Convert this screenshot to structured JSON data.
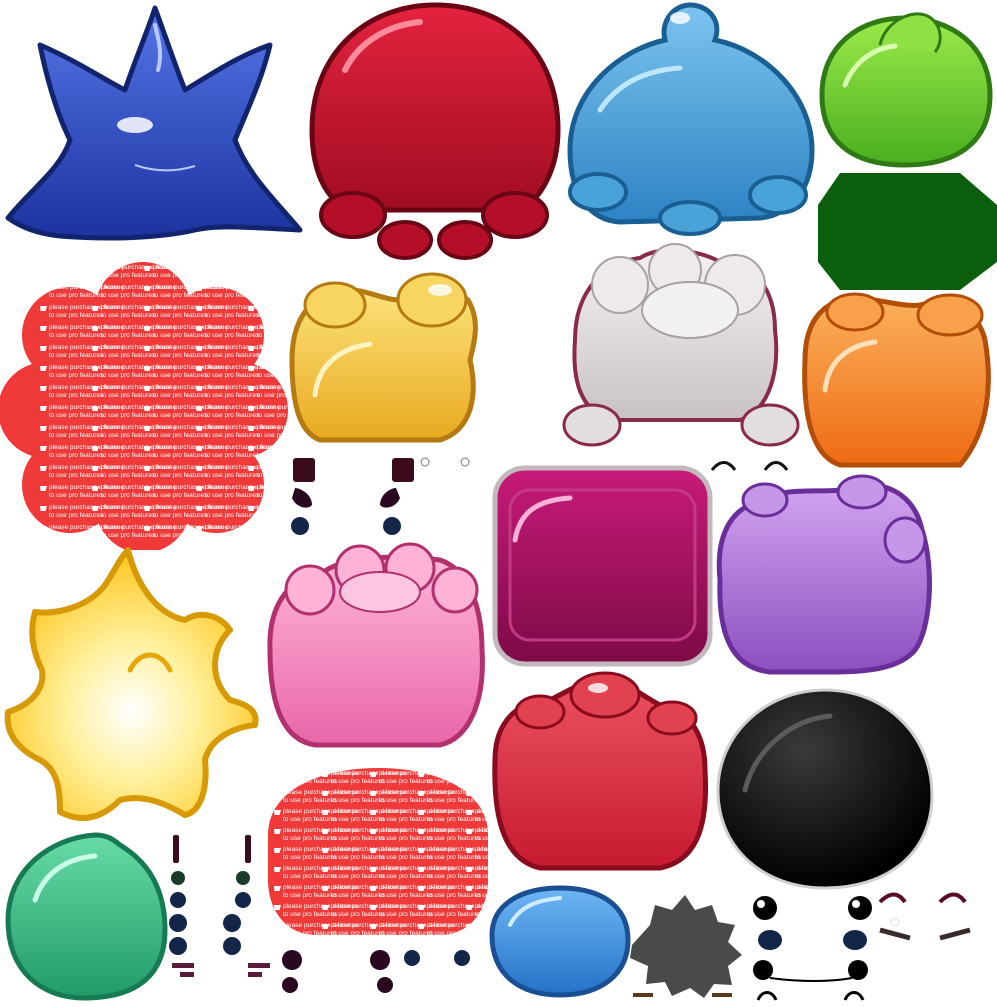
{
  "sheet": {
    "watermark": {
      "line1": "please purchase a license",
      "line2": "to use pro features"
    },
    "sprites": [
      {
        "name": "blue-spiky-slime",
        "color": "#2f4fc4"
      },
      {
        "name": "red-octopus-slime",
        "color": "#c8102e"
      },
      {
        "name": "sky-blue-slime",
        "color": "#4aa3d8"
      },
      {
        "name": "green-drop-slime",
        "color": "#6ccf2e"
      },
      {
        "name": "dark-green-octagon",
        "color": "#0b5e0b"
      },
      {
        "name": "red-flower-slime",
        "color": "#f03a3a"
      },
      {
        "name": "yellow-bear-slime",
        "color": "#f2c63c"
      },
      {
        "name": "white-bubbly-slime",
        "color": "#ded9da"
      },
      {
        "name": "orange-bear-slime",
        "color": "#f58a2c"
      },
      {
        "name": "magenta-cube-slime",
        "color": "#a0105e"
      },
      {
        "name": "purple-slime",
        "color": "#a970d6"
      },
      {
        "name": "yellow-starburst",
        "color": "#ffd83a"
      },
      {
        "name": "pink-bubbly-slime",
        "color": "#f48cc0"
      },
      {
        "name": "red-round-slime",
        "color": "#d8283c"
      },
      {
        "name": "black-ball-slime",
        "color": "#111111"
      },
      {
        "name": "teal-drop-slime",
        "color": "#36b583"
      },
      {
        "name": "red-dome-slime",
        "color": "#f03a3a"
      },
      {
        "name": "blue-blob-slime",
        "color": "#3b8fe0"
      },
      {
        "name": "gray-spiky-blob",
        "color": "#555555"
      }
    ]
  }
}
